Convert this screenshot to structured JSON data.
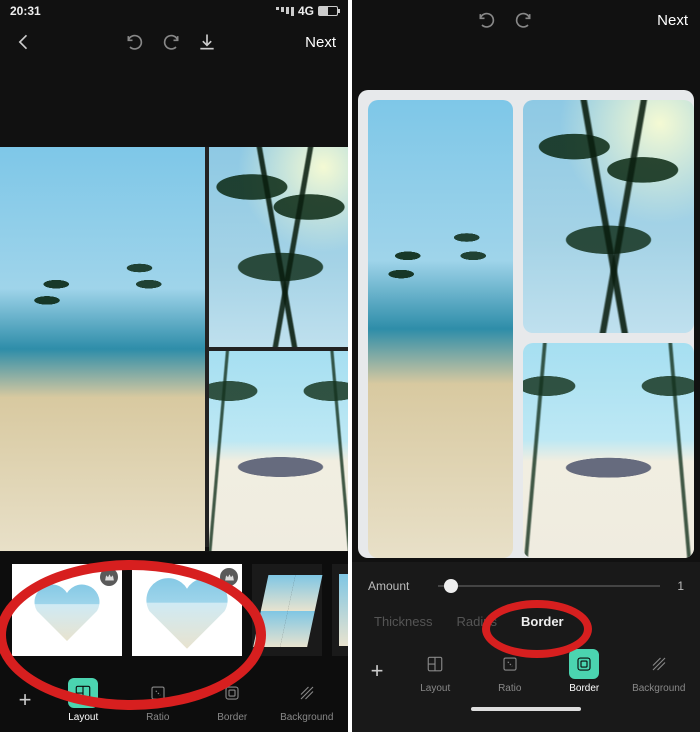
{
  "status": {
    "time": "20:31",
    "network_label": "4G"
  },
  "top": {
    "next_label": "Next"
  },
  "left": {
    "tabs": {
      "layout": "Layout",
      "ratio": "Ratio",
      "border": "Border",
      "background": "Background"
    },
    "active_tab": "layout"
  },
  "right": {
    "slider": {
      "label": "Amount",
      "value": 1,
      "min": 0,
      "max": 20,
      "display": "1"
    },
    "sub_tabs": {
      "thickness": "Thickness",
      "radius": "Radius",
      "border": "Border",
      "active": "border"
    },
    "tabs": {
      "layout": "Layout",
      "ratio": "Ratio",
      "border": "Border",
      "background": "Background"
    },
    "active_tab": "border"
  },
  "icons": {
    "back": "back-icon",
    "undo": "undo-icon",
    "redo": "redo-icon",
    "download": "download-icon",
    "plus": "plus-icon",
    "layout": "layout-icon",
    "ratio": "ratio-icon",
    "border": "border-icon",
    "background": "background-icon",
    "crown": "crown-icon"
  }
}
